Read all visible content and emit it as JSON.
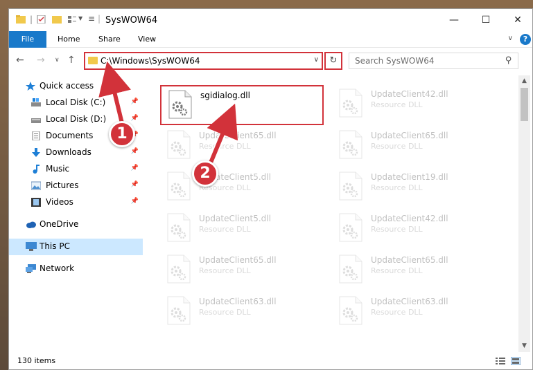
{
  "window": {
    "title": "SysWOW64"
  },
  "ribbon": {
    "tabs": [
      "File",
      "Home",
      "Share",
      "View"
    ],
    "help_label": "?"
  },
  "address": {
    "path": "C:\\Windows\\SysWOW64",
    "search_placeholder": "Search SysWOW64"
  },
  "sidebar": {
    "items": [
      {
        "label": "Quick access",
        "icon": "star-icon",
        "pinned": false
      },
      {
        "label": "Local Disk (C:)",
        "icon": "drive-icon",
        "pinned": true
      },
      {
        "label": "Local Disk (D:)",
        "icon": "drive-icon",
        "pinned": true
      },
      {
        "label": "Documents",
        "icon": "documents-icon",
        "pinned": true
      },
      {
        "label": "Downloads",
        "icon": "download-icon",
        "pinned": true
      },
      {
        "label": "Music",
        "icon": "music-icon",
        "pinned": true
      },
      {
        "label": "Pictures",
        "icon": "pictures-icon",
        "pinned": true
      },
      {
        "label": "Videos",
        "icon": "videos-icon",
        "pinned": true
      },
      {
        "label": "OneDrive",
        "icon": "cloud-icon",
        "pinned": false
      },
      {
        "label": "This PC",
        "icon": "computer-icon",
        "pinned": false,
        "selected": true
      },
      {
        "label": "Network",
        "icon": "network-icon",
        "pinned": false
      }
    ]
  },
  "files": [
    {
      "name": "sgidialog.dll",
      "type": "",
      "highlight": true
    },
    {
      "name": "UpdateClient42.dll",
      "type": "Resource DLL"
    },
    {
      "name": "UpdateClient65.dll",
      "type": "Resource DLL"
    },
    {
      "name": "UpdateClient65.dll",
      "type": "Resource DLL"
    },
    {
      "name": "UpdateClient5.dll",
      "type": "Resource DLL"
    },
    {
      "name": "UpdateClient19.dll",
      "type": "Resource DLL"
    },
    {
      "name": "UpdateClient5.dll",
      "type": "Resource DLL"
    },
    {
      "name": "UpdateClient42.dll",
      "type": "Resource DLL"
    },
    {
      "name": "UpdateClient65.dll",
      "type": "Resource DLL"
    },
    {
      "name": "UpdateClient65.dll",
      "type": "Resource DLL"
    },
    {
      "name": "UpdateClient63.dll",
      "type": "Resource DLL"
    },
    {
      "name": "UpdateClient63.dll",
      "type": "Resource DLL"
    }
  ],
  "status": {
    "count": "130 items"
  },
  "annotations": [
    {
      "label": "1"
    },
    {
      "label": "2"
    }
  ],
  "colors": {
    "accent": "#1979ca",
    "highlight": "#d2323a",
    "selected_bg": "#cce8ff"
  }
}
